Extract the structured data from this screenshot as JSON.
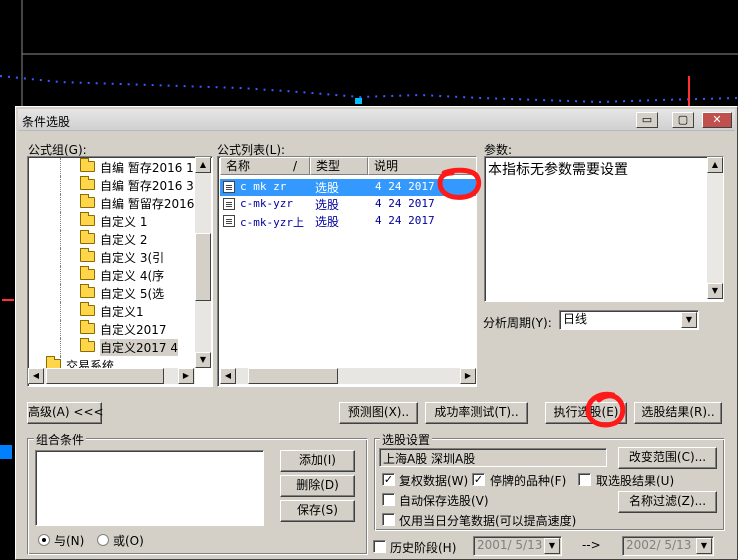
{
  "dialog": {
    "title": "条件选股",
    "window_buttons": {
      "minimize": "▭",
      "maximize": "▢",
      "close": "✕"
    }
  },
  "formula_group": {
    "label": "公式组(G):",
    "items": [
      {
        "label": "自编  暂存2016  1"
      },
      {
        "label": "自编  暂存2016  3"
      },
      {
        "label": "自编  暂留存2016"
      },
      {
        "label": "自定义  1"
      },
      {
        "label": "自定义  2"
      },
      {
        "label": "自定义  3(引"
      },
      {
        "label": "自定义  4(序"
      },
      {
        "label": "自定义  5(选"
      },
      {
        "label": "自定义1"
      },
      {
        "label": "自定义2017"
      },
      {
        "label": "自定义2017 4"
      },
      {
        "label": "交易系统"
      }
    ]
  },
  "formula_list": {
    "label": "公式列表(L):",
    "columns": [
      "名称",
      "/",
      "类型",
      "说明"
    ],
    "rows": [
      {
        "name": "c mk zr",
        "type": "选股",
        "desc": "4 24 2017"
      },
      {
        "name": "c-mk-yzr",
        "type": "选股",
        "desc": "4 24 2017"
      },
      {
        "name": "c-mk-yzr上",
        "type": "选股",
        "desc": "4 24 2017"
      }
    ]
  },
  "params": {
    "label": "参数:",
    "text": "本指标无参数需要设置",
    "period_label": "分析周期(Y):",
    "period_value": "日线"
  },
  "toolbar": {
    "advanced": "高级(A) <<<",
    "preview": "预测图(X)..",
    "success_rate": "成功率测试(T)..",
    "execute": "执行选股(E)",
    "results": "选股结果(R).."
  },
  "combo_conditions": {
    "label": "组合条件",
    "add": "添加(I)",
    "delete": "删除(D)",
    "save": "保存(S)",
    "and_label": "与(N)",
    "or_label": "或(O)"
  },
  "selection_settings": {
    "label": "选股设置",
    "range_text": "上海A股  深圳A股",
    "change_range": "改变范围(C)...",
    "rights": "复权数据(W)",
    "suspended": "停牌的品种(F)",
    "take_results": "取选股结果(U)",
    "auto_save": "自动保存选股(V)",
    "name_filter": "名称过滤(Z)...",
    "only_today": "仅用当日分笔数据(可以提高速度)",
    "history": "历史阶段(H)",
    "date_from": "2001/ 5/13",
    "arrow": "-->",
    "date_to": "2002/ 5/13"
  },
  "colors": {
    "selection_blue": "#3399ff",
    "annotation_red": "#ff1a1a",
    "dialog_face": "#d4d0c8"
  }
}
